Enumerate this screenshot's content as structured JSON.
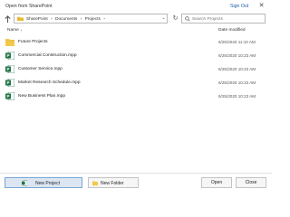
{
  "window": {
    "title": "Open from SharePoint",
    "sign_out_label": "Sign Out",
    "close_icon": "close-icon"
  },
  "navigation": {
    "up_icon": "up-arrow-icon",
    "breadcrumbs": [
      "SharePoint",
      "Documents",
      "Projects"
    ],
    "separator": "›",
    "refresh_icon": "refresh-icon",
    "search_placeholder": "Search Projects"
  },
  "columns": {
    "name": "Name",
    "sort_indicator": "↑",
    "date_modified": "Date modified"
  },
  "items": [
    {
      "type": "folder",
      "icon": "folder-icon",
      "name": "Future Projects",
      "date": "6/25/2020 11:10 AM"
    },
    {
      "type": "project",
      "icon": "project-file-icon",
      "name": "Commercial Construction.mpp",
      "date": "6/25/2020 10:23 AM"
    },
    {
      "type": "project",
      "icon": "project-file-icon",
      "name": "Customer Service.mpp",
      "date": "6/25/2020 10:23 AM"
    },
    {
      "type": "project",
      "icon": "project-file-icon",
      "name": "Market Research Schedule.mpp",
      "date": "6/25/2020 10:23 AM"
    },
    {
      "type": "project",
      "icon": "project-file-icon",
      "name": "New Business Plan.mpp",
      "date": "6/25/2020 10:23 AM"
    }
  ],
  "footer": {
    "new_project_label": "New Project",
    "new_folder_label": "New Folder",
    "open_label": "Open",
    "close_label": "Close"
  },
  "colors": {
    "project_green": "#217346",
    "folder_yellow": "#f2c94c",
    "link_blue": "#1e5fa8",
    "selected_button_bg": "#dce6f2"
  }
}
